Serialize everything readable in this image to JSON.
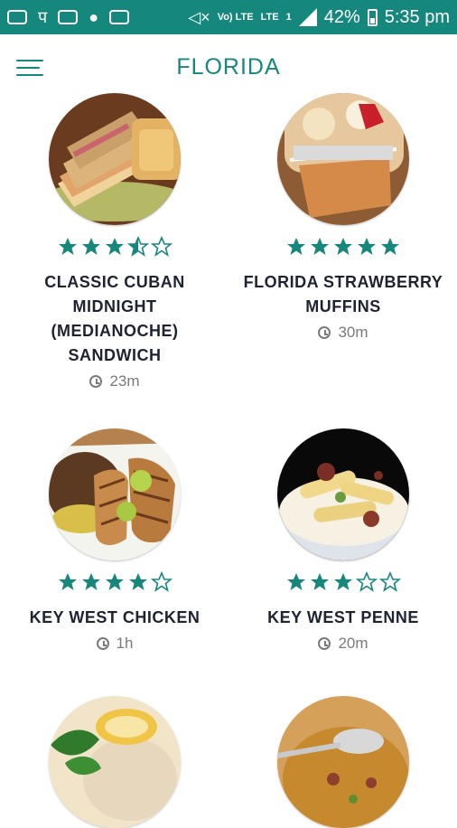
{
  "status_bar": {
    "battery_percent": "42%",
    "time": "5:35 pm",
    "network_labels": [
      "Vo) LTE",
      "LTE"
    ],
    "sim_slot": "1",
    "icons": [
      "message-icon",
      "app-icon",
      "image-icon",
      "android-icon",
      "mail-icon",
      "mute-icon",
      "signal-icon",
      "battery-icon"
    ]
  },
  "app_bar": {
    "title": "FLORIDA",
    "menu_icon": "hamburger-menu-icon"
  },
  "colors": {
    "accent": "#16877d",
    "title_text": "#1e2233",
    "meta_text": "#7a7a7a"
  },
  "recipes": [
    {
      "name": "CLASSIC CUBAN MIDNIGHT (MEDIANOCHE) SANDWICH",
      "rating": 3.5,
      "time": "23m",
      "image": "cuban-sandwich-image"
    },
    {
      "name": "FLORIDA STRAWBERRY MUFFINS",
      "rating": 5,
      "time": "30m",
      "image": "strawberry-muffins-image"
    },
    {
      "name": "KEY WEST CHICKEN",
      "rating": 4,
      "time": "1h",
      "image": "key-west-chicken-image"
    },
    {
      "name": "KEY WEST PENNE",
      "rating": 3,
      "time": "20m",
      "image": "key-west-penne-image"
    },
    {
      "name": "",
      "rating": null,
      "time": "",
      "image": "rice-lemon-image"
    },
    {
      "name": "",
      "rating": null,
      "time": "",
      "image": "soup-spoon-image"
    }
  ]
}
